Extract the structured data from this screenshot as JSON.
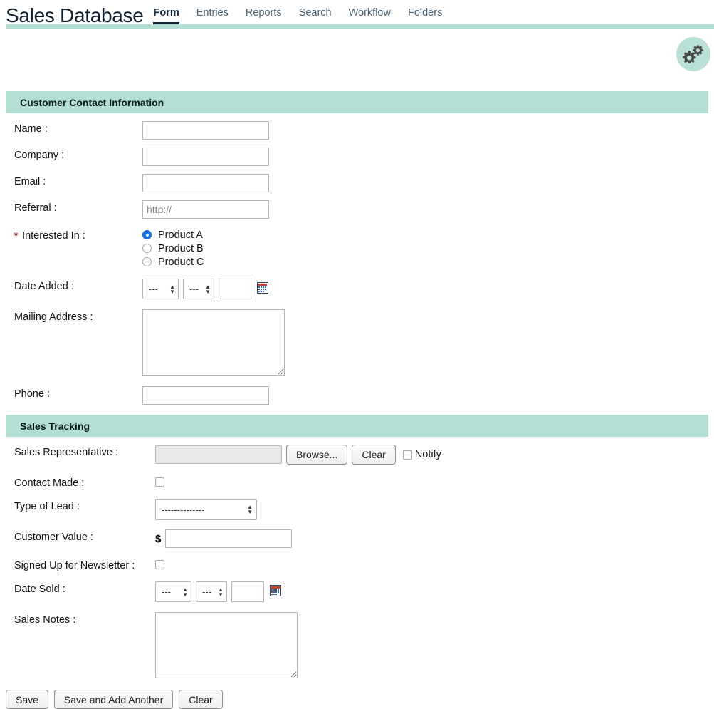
{
  "header": {
    "app_title": "Sales Database",
    "nav": [
      {
        "label": "Form",
        "active": true
      },
      {
        "label": "Entries",
        "active": false
      },
      {
        "label": "Reports",
        "active": false
      },
      {
        "label": "Search",
        "active": false
      },
      {
        "label": "Workflow",
        "active": false
      },
      {
        "label": "Folders",
        "active": false
      }
    ],
    "settings_icon": "gears-icon"
  },
  "colors": {
    "teal": "#b3ded4",
    "teal_badge": "#b8e0d7",
    "nav_active": "#12293b",
    "required_asterisk": "#8b1111",
    "radio_selected": "#1773e8"
  },
  "sections": [
    {
      "id": "customer_contact",
      "title": "Customer Contact Information",
      "fields": {
        "name": {
          "label": "Name :",
          "value": "",
          "placeholder": ""
        },
        "company": {
          "label": "Company :",
          "value": "",
          "placeholder": ""
        },
        "email": {
          "label": "Email :",
          "value": "",
          "placeholder": ""
        },
        "referral": {
          "label": "Referral :",
          "value": "",
          "placeholder": "http://"
        },
        "interested_in": {
          "label": "Interested In :",
          "required_marker": "*",
          "options": [
            {
              "label": "Product A",
              "selected": true
            },
            {
              "label": "Product B",
              "selected": false
            },
            {
              "label": "Product C",
              "selected": false
            }
          ]
        },
        "date_added": {
          "label": "Date Added :",
          "month_value": "---",
          "day_value": "---",
          "year_value": "",
          "calendar_icon": "calendar-icon"
        },
        "mailing_address": {
          "label": "Mailing Address :",
          "value": ""
        },
        "phone": {
          "label": "Phone :",
          "value": ""
        }
      }
    },
    {
      "id": "sales_tracking",
      "title": "Sales Tracking",
      "fields": {
        "sales_representative": {
          "label": "Sales Representative :",
          "file_value": "",
          "browse_label": "Browse...",
          "clear_label": "Clear",
          "notify_label": "Notify",
          "notify_checked": false
        },
        "contact_made": {
          "label": "Contact Made :",
          "checked": false
        },
        "type_of_lead": {
          "label": "Type of Lead :",
          "value": "--------------"
        },
        "customer_value": {
          "label": "Customer Value :",
          "currency": "$",
          "value": ""
        },
        "newsletter": {
          "label": "Signed Up for Newsletter :",
          "checked": false
        },
        "date_sold": {
          "label": "Date Sold :",
          "month_value": "---",
          "day_value": "---",
          "year_value": "",
          "calendar_icon": "calendar-icon"
        },
        "sales_notes": {
          "label": "Sales Notes :",
          "value": ""
        }
      }
    }
  ],
  "footer": {
    "save_label": "Save",
    "save_add_another_label": "Save and Add Another",
    "clear_label": "Clear"
  }
}
